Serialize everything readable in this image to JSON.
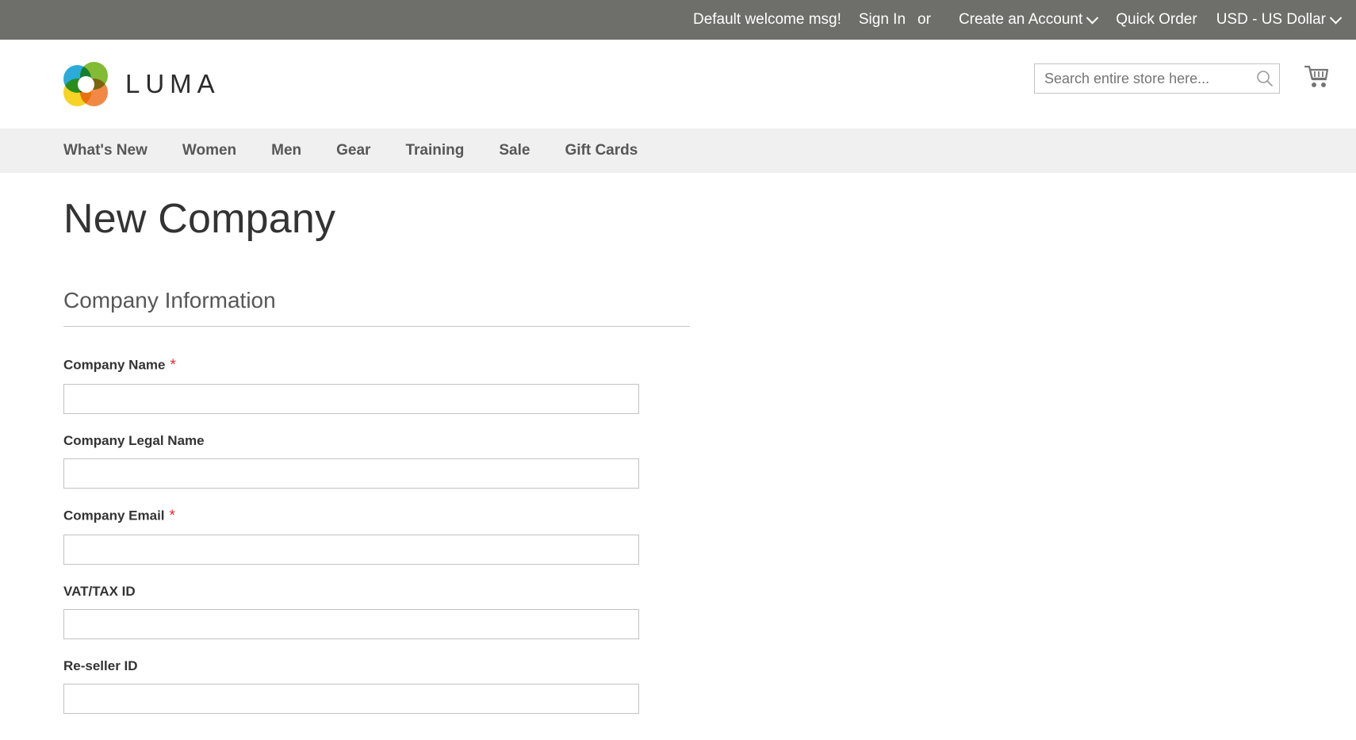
{
  "top_panel": {
    "welcome_message": "Default welcome msg!",
    "sign_in_label": "Sign In",
    "or_label": "or",
    "create_account_label": "Create an Account",
    "quick_order_label": "Quick Order",
    "currency_label": "USD - US Dollar",
    "background_color": "#6e6e6a",
    "text_color": "#ffffff"
  },
  "header": {
    "logo_text": "LUMA",
    "logo_colors": {
      "blue": "#1ea7d8",
      "green": "#7ab929",
      "orange": "#f1833a",
      "yellow": "#f7d117"
    },
    "search": {
      "placeholder": "Search entire store here...",
      "value": ""
    },
    "cart_icon_name": "shopping-cart-icon"
  },
  "nav": {
    "background_color": "#f0f0f0",
    "items": [
      {
        "label": "What's New"
      },
      {
        "label": "Women"
      },
      {
        "label": "Men"
      },
      {
        "label": "Gear"
      },
      {
        "label": "Training"
      },
      {
        "label": "Sale"
      },
      {
        "label": "Gift Cards"
      }
    ]
  },
  "main": {
    "page_title": "New Company",
    "fieldset_legend": "Company Information",
    "required_marker": "*",
    "required_marker_color": "#e02b27",
    "fields": [
      {
        "label": "Company Name",
        "required": true,
        "value": "",
        "name": "company-name"
      },
      {
        "label": "Company Legal Name",
        "required": false,
        "value": "",
        "name": "company-legal-name"
      },
      {
        "label": "Company Email",
        "required": true,
        "value": "",
        "name": "company-email"
      },
      {
        "label": "VAT/TAX ID",
        "required": false,
        "value": "",
        "name": "vat-tax-id"
      },
      {
        "label": "Re-seller ID",
        "required": false,
        "value": "",
        "name": "re-seller-id"
      }
    ]
  }
}
